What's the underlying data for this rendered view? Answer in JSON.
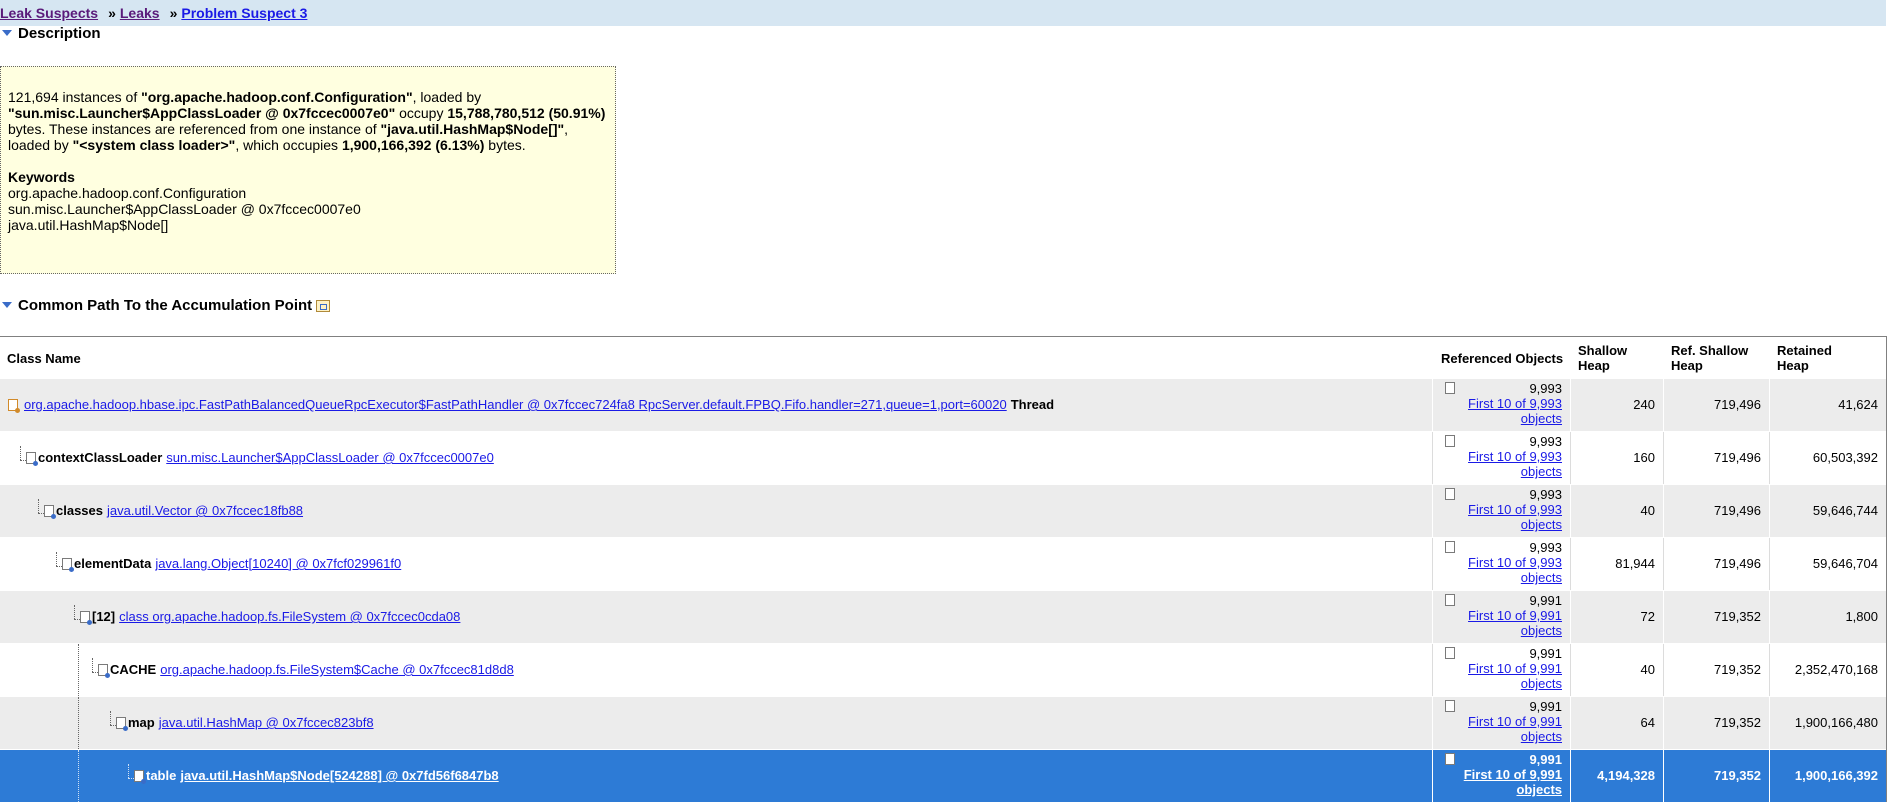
{
  "breadcrumb": {
    "item1": "Leak Suspects",
    "sep": "»",
    "item2": "Leaks",
    "item3": "Problem Suspect 3"
  },
  "description": {
    "heading": "Description",
    "count": "121,694",
    "text_instances_of": " instances of ",
    "class_name": "\"org.apache.hadoop.conf.Configuration\"",
    "text_loaded_by": ", loaded by",
    "loader": "\"sun.misc.Launcher$AppClassLoader @ 0x7fccec0007e0\"",
    "text_occupy": " occupy",
    "bytes": "15,788,780,512 (50.91%)",
    "text_bytes_ref": " bytes. These instances are referenced from one instance of ",
    "ref_class": "\"java.util.HashMap$Node[]\"",
    "text_loaded_by2": ", loaded by ",
    "ref_loader": "\"<system class loader>\"",
    "text_which": ", which occupies ",
    "ref_bytes": "1,900,166,392 (6.13%)",
    "text_end": " bytes.",
    "keywords_title": "Keywords",
    "keywords": [
      "org.apache.hadoop.conf.Configuration",
      "sun.misc.Launcher$AppClassLoader @ 0x7fccec0007e0",
      "java.util.HashMap$Node[]"
    ]
  },
  "accumulation": {
    "heading": "Common Path To the Accumulation Point",
    "export_icon": "export-icon"
  },
  "table": {
    "headers": {
      "class_name": "Class Name",
      "referenced": "Referenced Objects",
      "shallow_1": "Shallow",
      "shallow_2": "Heap",
      "ref_shallow_1": "Ref. Shallow",
      "ref_shallow_2": "Heap",
      "retained_1": "Retained",
      "retained_2": "Heap"
    },
    "rows": [
      {
        "label": "",
        "link": "org.apache.hadoop.hbase.ipc.FastPathBalancedQueueRpcExecutor$FastPathHandler @ 0x7fccec724fa8 RpcServer.default.FPBQ.Fifo.handler=271,queue=1,port=60020",
        "suffix": "Thread",
        "ref_count": "9,993",
        "ref_line1": "First 10 of 9,993",
        "ref_line2": "objects",
        "shallow": "240",
        "ref_shallow": "719,496",
        "retained": "41,624"
      },
      {
        "label": "contextClassLoader",
        "link": "sun.misc.Launcher$AppClassLoader @ 0x7fccec0007e0",
        "suffix": "",
        "ref_count": "9,993",
        "ref_line1": "First 10 of 9,993",
        "ref_line2": "objects",
        "shallow": "160",
        "ref_shallow": "719,496",
        "retained": "60,503,392"
      },
      {
        "label": "classes",
        "link": "java.util.Vector @ 0x7fccec18fb88",
        "suffix": "",
        "ref_count": "9,993",
        "ref_line1": "First 10 of 9,993",
        "ref_line2": "objects",
        "shallow": "40",
        "ref_shallow": "719,496",
        "retained": "59,646,744"
      },
      {
        "label": "elementData",
        "link": "java.lang.Object[10240] @ 0x7fcf029961f0",
        "suffix": "",
        "ref_count": "9,993",
        "ref_line1": "First 10 of 9,993",
        "ref_line2": "objects",
        "shallow": "81,944",
        "ref_shallow": "719,496",
        "retained": "59,646,704"
      },
      {
        "label": "[12]",
        "link": "class org.apache.hadoop.fs.FileSystem @ 0x7fccec0cda08",
        "suffix": "",
        "ref_count": "9,991",
        "ref_line1": "First 10 of 9,991",
        "ref_line2": "objects",
        "shallow": "72",
        "ref_shallow": "719,352",
        "retained": "1,800"
      },
      {
        "label": "CACHE",
        "link": "org.apache.hadoop.fs.FileSystem$Cache @ 0x7fccec81d8d8",
        "suffix": "",
        "ref_count": "9,991",
        "ref_line1": "First 10 of 9,991",
        "ref_line2": "objects",
        "shallow": "40",
        "ref_shallow": "719,352",
        "retained": "2,352,470,168"
      },
      {
        "label": "map",
        "link": "java.util.HashMap @ 0x7fccec823bf8",
        "suffix": "",
        "ref_count": "9,991",
        "ref_line1": "First 10 of 9,991",
        "ref_line2": "objects",
        "shallow": "64",
        "ref_shallow": "719,352",
        "retained": "1,900,166,480"
      },
      {
        "label": "table",
        "link": "java.util.HashMap$Node[524288] @ 0x7fd56f6847b8",
        "suffix": "",
        "ref_count": "9,991",
        "ref_line1": "First 10 of 9,991",
        "ref_line2": "objects",
        "shallow": "4,194,328",
        "ref_shallow": "719,352",
        "retained": "1,900,166,392"
      }
    ]
  }
}
